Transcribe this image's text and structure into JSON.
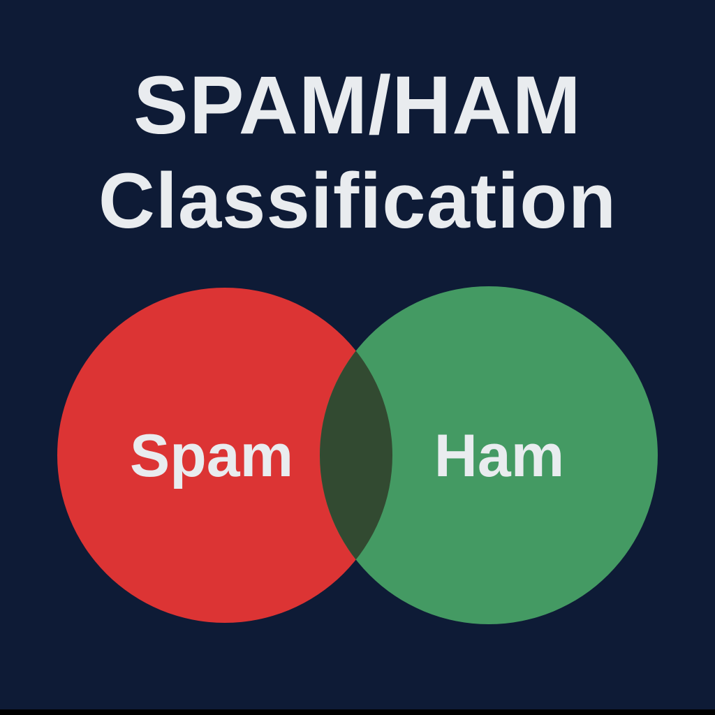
{
  "title": {
    "line1": "SPAM/HAM",
    "line2": "Classification"
  },
  "venn": {
    "left_set": {
      "label": "Spam",
      "color": "#dc3434"
    },
    "right_set": {
      "label": "Ham",
      "color": "#449a63"
    },
    "overlap_color": "#324a31",
    "label_color": "#e9ecef"
  },
  "colors": {
    "background": "#0e1b36",
    "title_text": "#e9ecef"
  }
}
